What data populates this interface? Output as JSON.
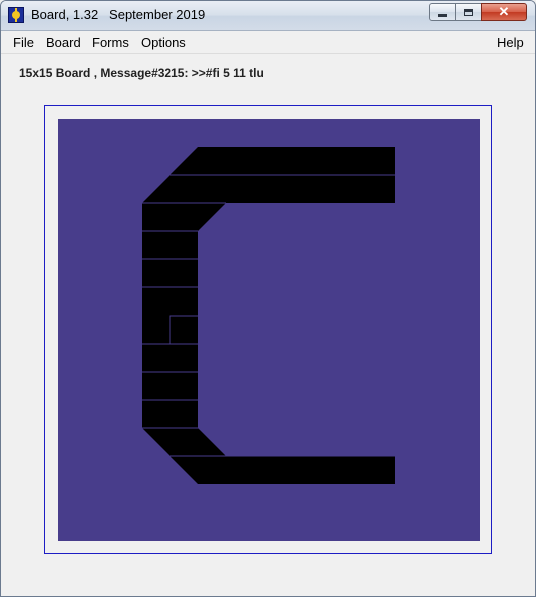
{
  "window": {
    "title": "Board, 1.32   September 2019",
    "icon": "board-app-icon",
    "controls": {
      "minimize": "minimize-icon",
      "maximize": "maximize-icon",
      "close": "✕"
    }
  },
  "menu": {
    "file": "File",
    "board": "Board",
    "forms": "Forms",
    "options": "Options",
    "help": "Help"
  },
  "status": {
    "message": "15x15 Board , Message#3215: >>#fi 5 11 tlu"
  },
  "board": {
    "size": 15,
    "background_color": "#483d8b",
    "piece_color": "#000000",
    "frame_color": "#1d1dc4",
    "grid_line_color": "#483d8b",
    "shape": "C-shaped black piece with beveled corners"
  }
}
